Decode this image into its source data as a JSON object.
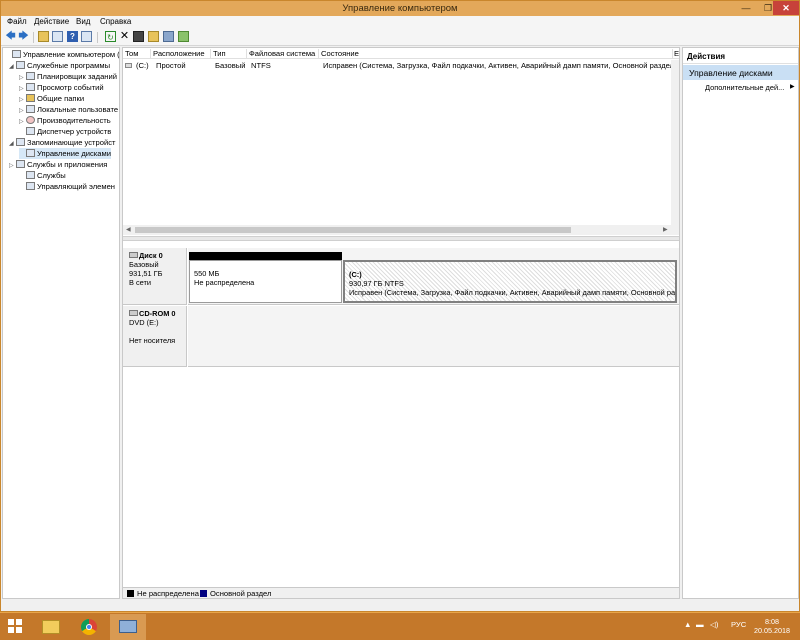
{
  "window": {
    "title": "Управление компьютером",
    "min_glyph": "—",
    "max_glyph": "❐",
    "close_glyph": "✕"
  },
  "menu": [
    "Файл",
    "Действие",
    "Вид",
    "Справка"
  ],
  "toolbar": {
    "icons": [
      "back-arrow-icon",
      "forward-arrow-icon",
      "up-folder-icon",
      "show-hide-tree-icon",
      "help-icon",
      "properties-icon",
      "refresh-icon",
      "delete-icon",
      "disk-icon",
      "folder-icon",
      "search-icon",
      "checklist-icon"
    ]
  },
  "tree": [
    {
      "label": "Управление компьютером (л",
      "level": 0,
      "expander": ""
    },
    {
      "label": "Служебные программы",
      "level": 1,
      "expander": "◢"
    },
    {
      "label": "Планировщик заданий",
      "level": 2,
      "expander": "▷"
    },
    {
      "label": "Просмотр событий",
      "level": 2,
      "expander": "▷"
    },
    {
      "label": "Общие папки",
      "level": 2,
      "expander": "▷"
    },
    {
      "label": "Локальные пользовате",
      "level": 2,
      "expander": "▷"
    },
    {
      "label": "Производительность",
      "level": 2,
      "expander": "▷"
    },
    {
      "label": "Диспетчер устройств",
      "level": 2,
      "expander": ""
    },
    {
      "label": "Запоминающие устройст",
      "level": 1,
      "expander": "◢"
    },
    {
      "label": "Управление дисками",
      "level": 2,
      "expander": "",
      "selected": true
    },
    {
      "label": "Службы и приложения",
      "level": 1,
      "expander": "▷"
    },
    {
      "label": "Службы",
      "level": 2,
      "expander": ""
    },
    {
      "label": "Управляющий элемен",
      "level": 2,
      "expander": ""
    }
  ],
  "volumes": {
    "columns": [
      "Том",
      "Расположение",
      "Тип",
      "Файловая система",
      "Состояние",
      "Е"
    ],
    "rows": [
      {
        "name": "(C:)",
        "layout": "Простой",
        "type": "Базовый",
        "fs": "NTFS",
        "status": "Исправен (Система, Загрузка, Файл подкачки, Активен, Аварийный дамп памяти, Основной раздел)"
      }
    ]
  },
  "disks": [
    {
      "name": "Диск 0",
      "type": "Базовый",
      "size": "931,51 ГБ",
      "state": "В сети",
      "partitions": [
        {
          "name": "",
          "size": "550 МБ",
          "status": "Не распределена",
          "color": "#000000"
        },
        {
          "name": "(C:)",
          "size": "930,97 ГБ NTFS",
          "status": "Исправен (Система, Загрузка, Файл подкачки, Активен, Аварийный дамп памяти, Основной раз",
          "color": "#000080"
        }
      ]
    },
    {
      "name": "CD-ROM 0",
      "type": "DVD (E:)",
      "size": "",
      "state": "Нет носителя",
      "partitions": []
    }
  ],
  "legend": [
    {
      "label": "Не распределена",
      "color": "#000000"
    },
    {
      "label": "Основной раздел",
      "color": "#000080"
    }
  ],
  "actions": {
    "title": "Действия",
    "group": "Управление дисками",
    "item": "Дополнительные дей...",
    "arrow": "▶"
  },
  "taskbar": {
    "apps": [
      "file-explorer-icon",
      "chrome-icon",
      "computer-management-icon"
    ],
    "language": "РУС",
    "time": "8:08",
    "date": "20.05.2018"
  }
}
